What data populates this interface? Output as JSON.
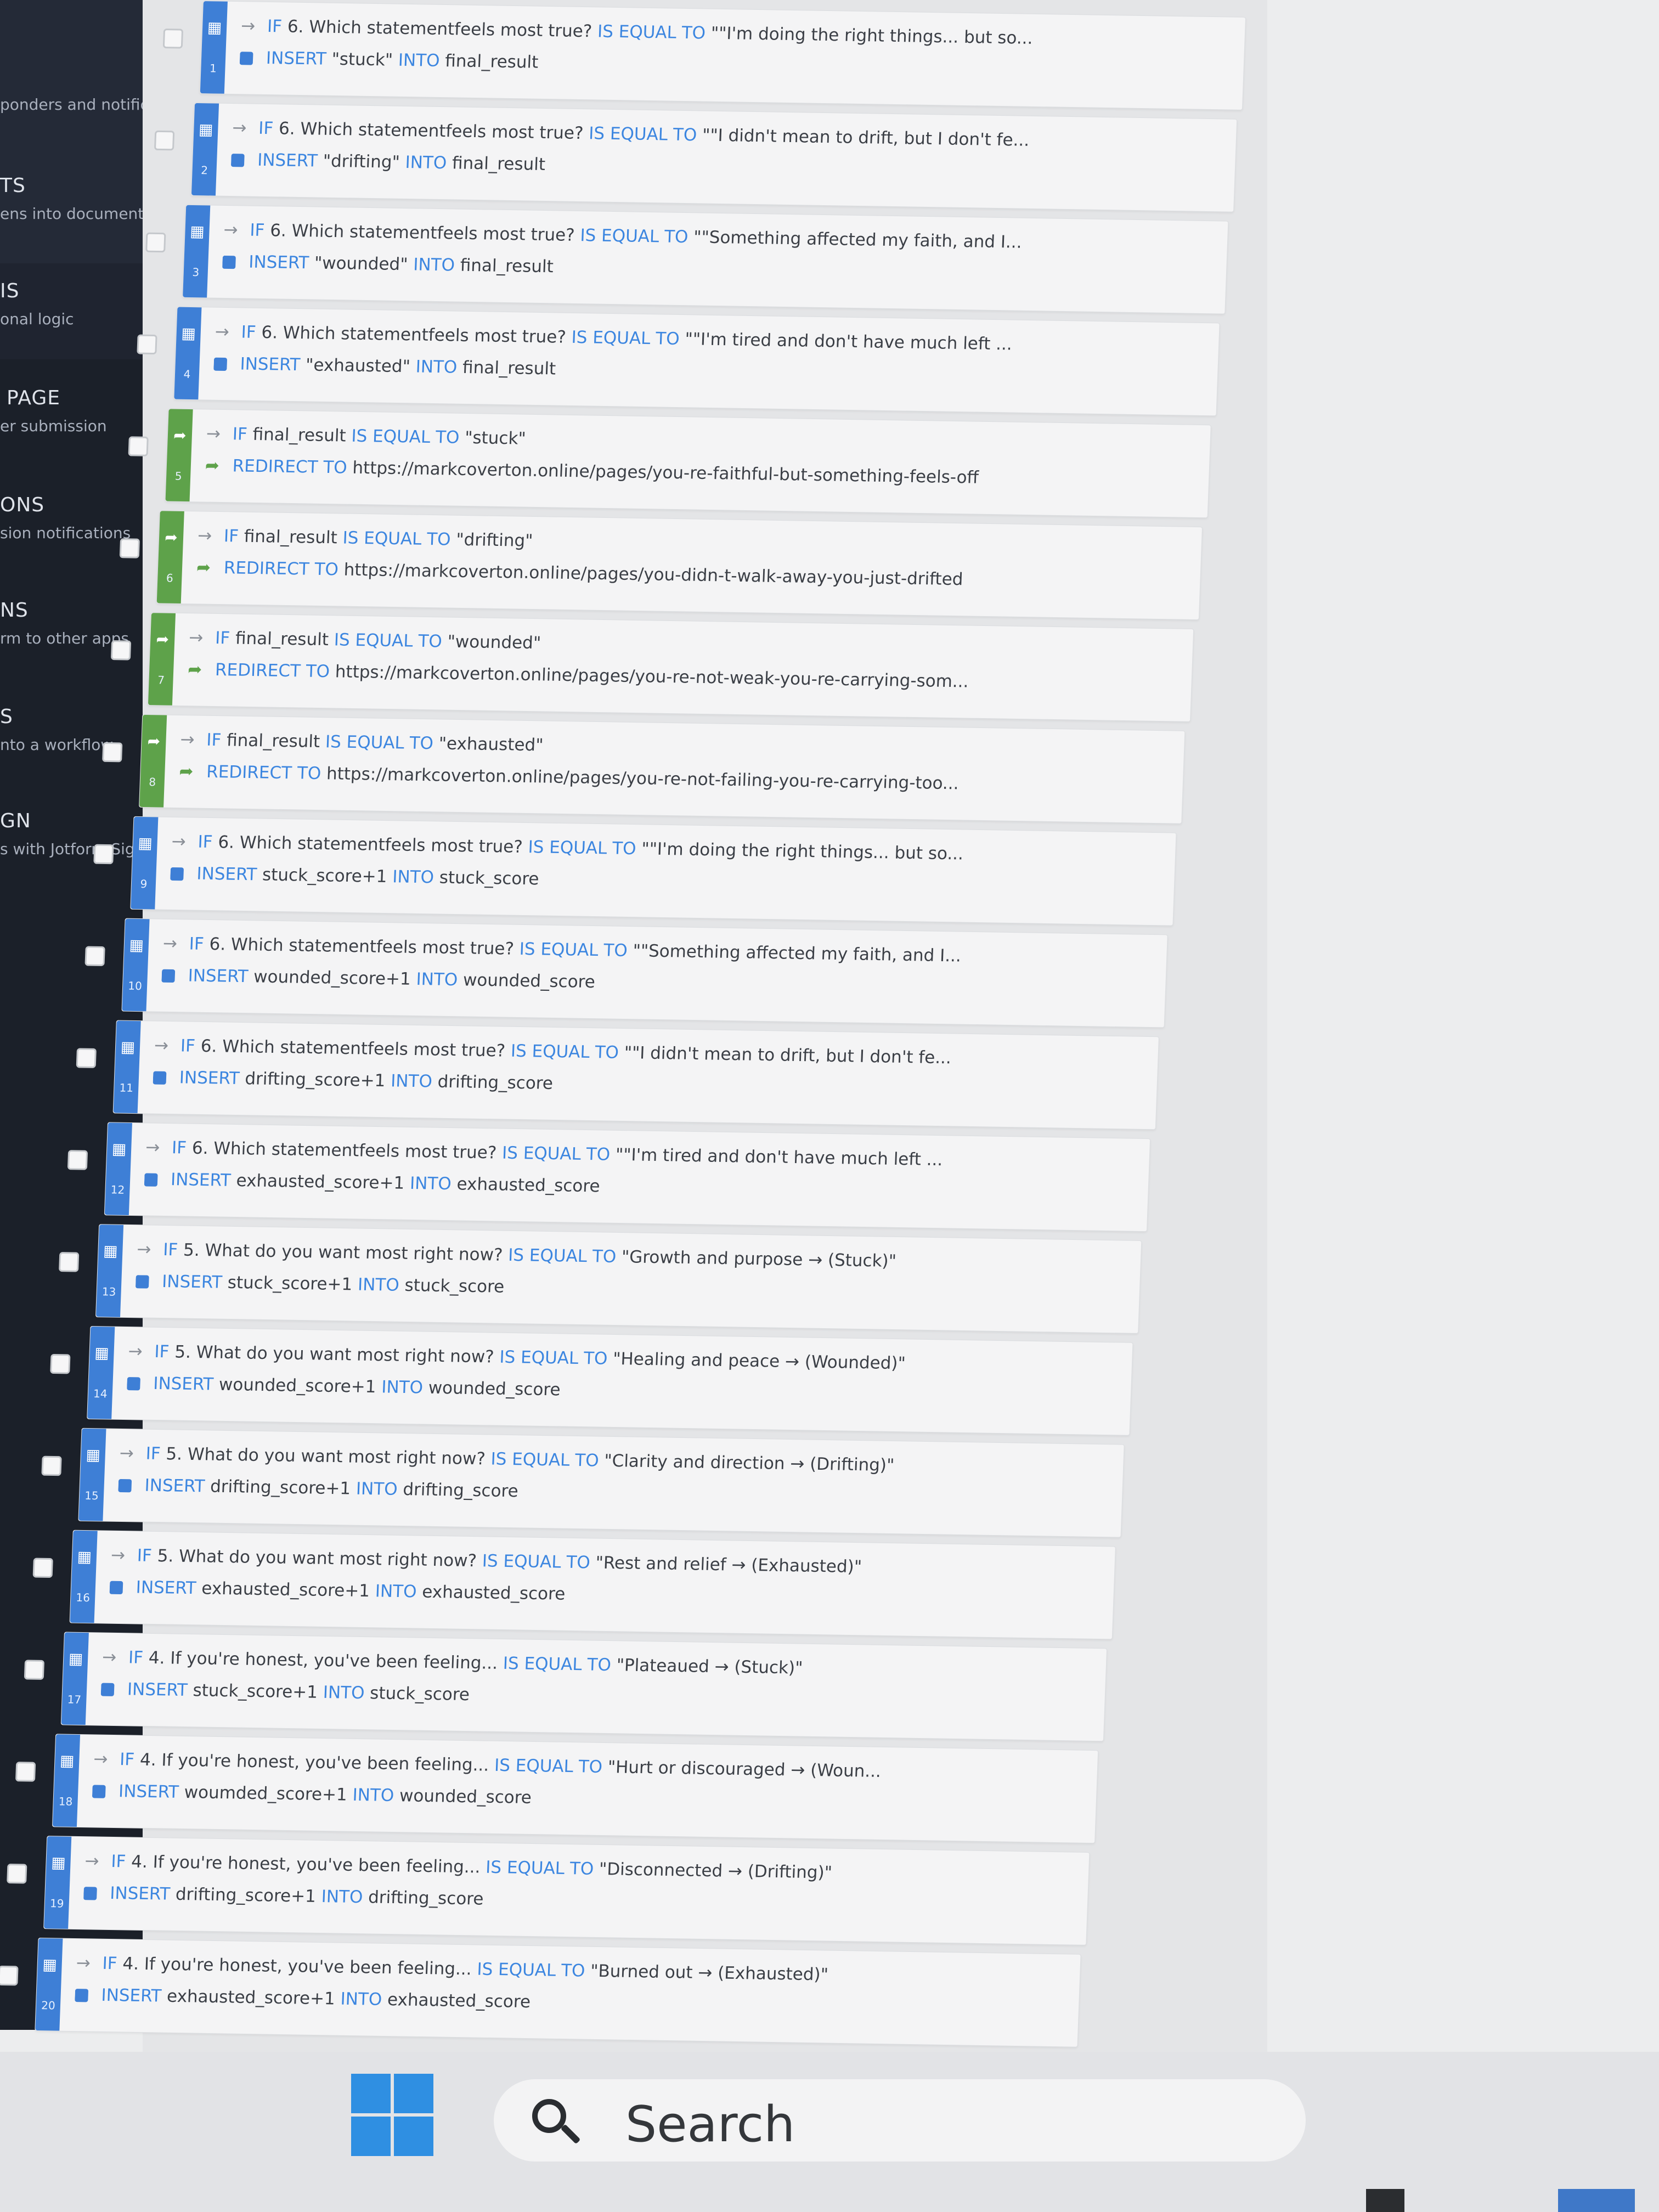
{
  "sidebar": {
    "items": [
      {
        "title": "",
        "subtitle": "ponders and notifications"
      },
      {
        "title": "TS",
        "subtitle": "ens into documents"
      },
      {
        "title": "IS",
        "subtitle": "onal logic"
      },
      {
        "title": "PAGE",
        "subtitle": "er submission"
      },
      {
        "title": "ONS",
        "subtitle": "sion notifications"
      },
      {
        "title": "NS",
        "subtitle": "rm to other apps"
      },
      {
        "title": "S",
        "subtitle": "nto a workflow"
      },
      {
        "title": "GN",
        "subtitle": "s with Jotform Sign"
      }
    ]
  },
  "rules": [
    {
      "n": "1",
      "kind": "calc",
      "field": "6. Which statementfeels most true?",
      "op": "IS EQUAL TO",
      "value": "\"\"I'm doing the right things... but so...",
      "action": "INSERT",
      "expr": "\"stuck\"",
      "into": "INTO",
      "target": "final_result"
    },
    {
      "n": "2",
      "kind": "calc",
      "field": "6. Which statementfeels most true?",
      "op": "IS EQUAL TO",
      "value": "\"\"I didn't mean to drift, but I don't fe...",
      "action": "INSERT",
      "expr": "\"drifting\"",
      "into": "INTO",
      "target": "final_result"
    },
    {
      "n": "3",
      "kind": "calc",
      "field": "6. Which statementfeels most true?",
      "op": "IS EQUAL TO",
      "value": "\"\"Something affected my faith, and I...",
      "action": "INSERT",
      "expr": "\"wounded\"",
      "into": "INTO",
      "target": "final_result"
    },
    {
      "n": "4",
      "kind": "calc",
      "field": "6. Which statementfeels most true?",
      "op": "IS EQUAL TO",
      "value": "\"\"I'm tired and don't have much left ...",
      "action": "INSERT",
      "expr": "\"exhausted\"",
      "into": "INTO",
      "target": "final_result"
    },
    {
      "n": "5",
      "kind": "redirect",
      "field": "final_result",
      "op": "IS EQUAL TO",
      "value": "\"stuck\"",
      "action": "REDIRECT TO",
      "url": "https://markcoverton.online/pages/you-re-faithful-but-something-feels-off"
    },
    {
      "n": "6",
      "kind": "redirect",
      "field": "final_result",
      "op": "IS EQUAL TO",
      "value": "\"drifting\"",
      "action": "REDIRECT TO",
      "url": "https://markcoverton.online/pages/you-didn-t-walk-away-you-just-drifted"
    },
    {
      "n": "7",
      "kind": "redirect",
      "field": "final_result",
      "op": "IS EQUAL TO",
      "value": "\"wounded\"",
      "action": "REDIRECT TO",
      "url": "https://markcoverton.online/pages/you-re-not-weak-you-re-carrying-som..."
    },
    {
      "n": "8",
      "kind": "redirect",
      "field": "final_result",
      "op": "IS EQUAL TO",
      "value": "\"exhausted\"",
      "action": "REDIRECT TO",
      "url": "https://markcoverton.online/pages/you-re-not-failing-you-re-carrying-too..."
    },
    {
      "n": "9",
      "kind": "calc",
      "field": "6. Which statementfeels most true?",
      "op": "IS EQUAL TO",
      "value": "\"\"I'm doing the right things... but so...",
      "action": "INSERT",
      "expr": "stuck_score+1",
      "into": "INTO",
      "target": "stuck_score"
    },
    {
      "n": "10",
      "kind": "calc",
      "field": "6. Which statementfeels most true?",
      "op": "IS EQUAL TO",
      "value": "\"\"Something affected my faith, and I...",
      "action": "INSERT",
      "expr": "wounded_score+1",
      "into": "INTO",
      "target": "wounded_score"
    },
    {
      "n": "11",
      "kind": "calc",
      "field": "6. Which statementfeels most true?",
      "op": "IS EQUAL TO",
      "value": "\"\"I didn't mean to drift, but I don't fe...",
      "action": "INSERT",
      "expr": "drifting_score+1",
      "into": "INTO",
      "target": "drifting_score"
    },
    {
      "n": "12",
      "kind": "calc",
      "field": "6. Which statementfeels most true?",
      "op": "IS EQUAL TO",
      "value": "\"\"I'm tired and don't have much left ...",
      "action": "INSERT",
      "expr": "exhausted_score+1",
      "into": "INTO",
      "target": "exhausted_score"
    },
    {
      "n": "13",
      "kind": "calc",
      "field": "5. What do you want most right now?",
      "op": "IS EQUAL TO",
      "value": "\"Growth and purpose → (Stuck)\"",
      "action": "INSERT",
      "expr": "stuck_score+1",
      "into": "INTO",
      "target": "stuck_score"
    },
    {
      "n": "14",
      "kind": "calc",
      "field": "5. What do you want most right now?",
      "op": "IS EQUAL TO",
      "value": "\"Healing and peace → (Wounded)\"",
      "action": "INSERT",
      "expr": "wounded_score+1",
      "into": "INTO",
      "target": "wounded_score"
    },
    {
      "n": "15",
      "kind": "calc",
      "field": "5. What do you want most right now?",
      "op": "IS EQUAL TO",
      "value": "\"Clarity and direction → (Drifting)\"",
      "action": "INSERT",
      "expr": "drifting_score+1",
      "into": "INTO",
      "target": "drifting_score"
    },
    {
      "n": "16",
      "kind": "calc",
      "field": "5. What do you want most right now?",
      "op": "IS EQUAL TO",
      "value": "\"Rest and relief → (Exhausted)\"",
      "action": "INSERT",
      "expr": "exhausted_score+1",
      "into": "INTO",
      "target": "exhausted_score"
    },
    {
      "n": "17",
      "kind": "calc",
      "field": "4. If you're honest, you've been feeling...",
      "op": "IS EQUAL TO",
      "value": "\"Plateaued → (Stuck)\"",
      "action": "INSERT",
      "expr": "stuck_score+1",
      "into": "INTO",
      "target": "stuck_score"
    },
    {
      "n": "18",
      "kind": "calc",
      "field": "4. If you're honest, you've been feeling...",
      "op": "IS EQUAL TO",
      "value": "\"Hurt or discouraged → (Woun...",
      "action": "INSERT",
      "expr": "woumded_score+1",
      "into": "INTO",
      "target": "wounded_score"
    },
    {
      "n": "19",
      "kind": "calc",
      "field": "4. If you're honest, you've been feeling...",
      "op": "IS EQUAL TO",
      "value": "\"Disconnected → (Drifting)\"",
      "action": "INSERT",
      "expr": "drifting_score+1",
      "into": "INTO",
      "target": "drifting_score"
    },
    {
      "n": "20",
      "kind": "calc",
      "field": "4. If you're honest, you've been feeling...",
      "op": "IS EQUAL TO",
      "value": "\"Burned out → (Exhausted)\"",
      "action": "INSERT",
      "expr": "exhausted_score+1",
      "into": "INTO",
      "target": "exhausted_score"
    }
  ],
  "keyword_if": "IF",
  "taskbar": {
    "search_label": "Search"
  },
  "colors": {
    "calc_accent": "#3e7fd6",
    "redirect_accent": "#5ea24a",
    "keyword": "#3c86e0",
    "sidebar_bg": "#1f2430"
  },
  "icons": {
    "calc": "calculator-icon",
    "redirect": "redirect-arrow-icon",
    "start": "windows-logo-icon",
    "search": "search-icon"
  }
}
